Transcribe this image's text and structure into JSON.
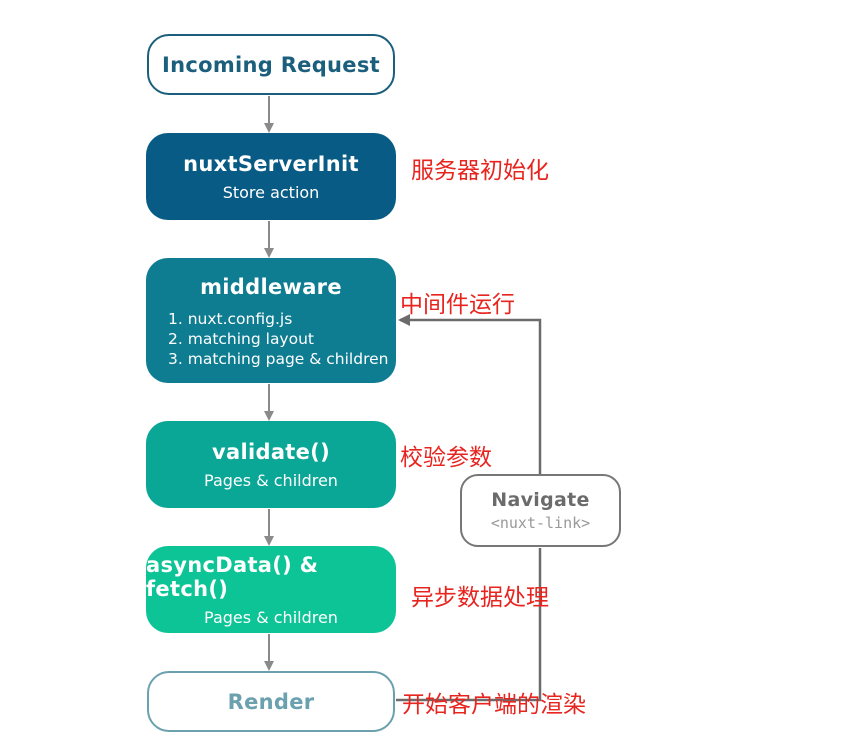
{
  "nodes": {
    "incoming": {
      "title": "Incoming Request"
    },
    "server_init": {
      "title": "nuxtServerInit",
      "subtitle": "Store action"
    },
    "middleware": {
      "title": "middleware",
      "steps": [
        "1. nuxt.config.js",
        "2. matching layout",
        "3. matching page & children"
      ]
    },
    "validate": {
      "title": "validate()",
      "subtitle": "Pages & children"
    },
    "async_data": {
      "title": "asyncData() & fetch()",
      "subtitle": "Pages & children"
    },
    "render": {
      "title": "Render"
    },
    "navigate": {
      "title": "Navigate",
      "subtitle": "<nuxt-link>"
    }
  },
  "annotations": {
    "server_init": "服务器初始化",
    "middleware": "中间件运行",
    "validate": "校验参数",
    "async_data": "异步数据处理",
    "render": "开始客户端的渲染"
  },
  "colors": {
    "server_init": "#085b84",
    "middleware": "#0e7c91",
    "validate": "#0aa696",
    "async_data": "#0cc495",
    "annotation": "#e8241f",
    "arrow": "#8a8a8a"
  }
}
